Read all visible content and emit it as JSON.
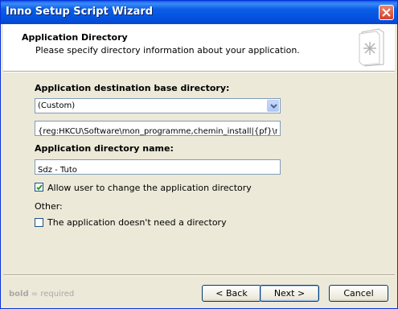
{
  "window": {
    "title": "Inno Setup Script Wizard"
  },
  "header": {
    "title": "Application Directory",
    "subtitle": "Please specify directory information about your application."
  },
  "form": {
    "base_dir_label": "Application destination base directory:",
    "base_dir_selected": "(Custom)",
    "custom_path_value": "{reg:HKCU\\Software\\mon_programme,chemin_install|{pf}\\mon_",
    "dir_name_label": "Application directory name:",
    "dir_name_value": "Sdz - Tuto",
    "allow_change_label": "Allow user to change the application directory",
    "allow_change_checked": true,
    "other_label": "Other:",
    "no_dir_label": "The application doesn't need a directory",
    "no_dir_checked": false
  },
  "footer": {
    "hint_bold": "bold",
    "hint_rest": " = required",
    "back_label": "< Back",
    "next_label": "Next >",
    "cancel_label": "Cancel"
  }
}
